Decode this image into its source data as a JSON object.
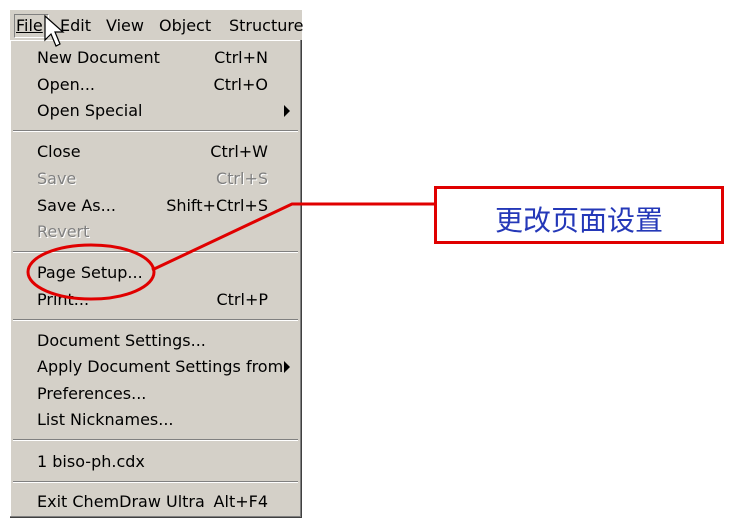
{
  "menubar": {
    "items": [
      {
        "label": "File"
      },
      {
        "label": "Edit"
      },
      {
        "label": "View"
      },
      {
        "label": "Object"
      },
      {
        "label": "Structure"
      }
    ]
  },
  "menu": {
    "new_document": {
      "label": "New Document",
      "shortcut": "Ctrl+N"
    },
    "open": {
      "label": "Open...",
      "shortcut": "Ctrl+O"
    },
    "open_special": {
      "label": "Open Special"
    },
    "close": {
      "label": "Close",
      "shortcut": "Ctrl+W"
    },
    "save": {
      "label": "Save",
      "shortcut": "Ctrl+S",
      "disabled": true
    },
    "save_as": {
      "label": "Save As...",
      "shortcut": "Shift+Ctrl+S"
    },
    "revert": {
      "label": "Revert",
      "disabled": true
    },
    "page_setup": {
      "label": "Page Setup..."
    },
    "print": {
      "label": "Print...",
      "shortcut": "Ctrl+P"
    },
    "document_settings": {
      "label": "Document Settings..."
    },
    "apply_document_settings": {
      "label": "Apply Document Settings from"
    },
    "preferences": {
      "label": "Preferences..."
    },
    "list_nicknames": {
      "label": "List Nicknames..."
    },
    "recent_file": {
      "label": "1 biso-ph.cdx"
    },
    "exit": {
      "label": "Exit ChemDraw Ultra",
      "shortcut": "Alt+F4"
    }
  },
  "annotation": {
    "text": "更改页面设置",
    "border_color": "#e00000",
    "text_color": "#2438b8"
  }
}
